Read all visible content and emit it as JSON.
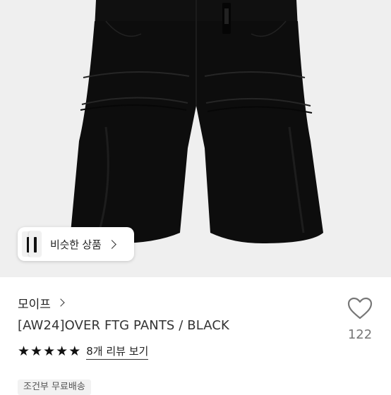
{
  "similar": {
    "label": "비슷한 상품",
    "icon": "chevron-right-icon"
  },
  "product": {
    "brand": "모이프",
    "title": "[AW24]OVER FTG PANTS / BLACK",
    "rating": 5,
    "review_link": "8개 리뷰 보기",
    "shipping_tag": "조건부 무료배송"
  },
  "like": {
    "icon": "heart-icon",
    "count": "122"
  },
  "colors": {
    "image_bg": "#efefef",
    "garment": "#0d0d0d"
  }
}
